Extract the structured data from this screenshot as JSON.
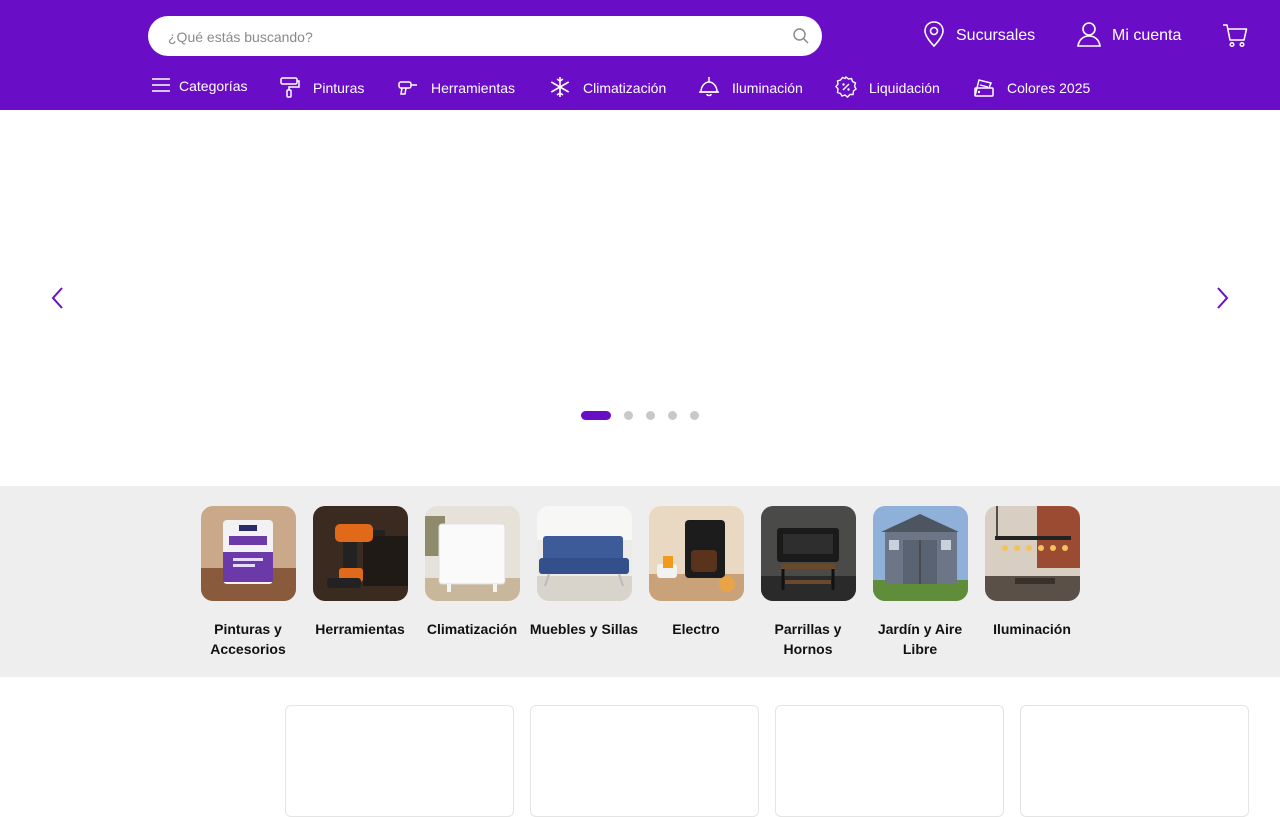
{
  "header": {
    "search": {
      "placeholder": "¿Qué estás buscando?",
      "value": ""
    },
    "links": {
      "stores": "Sucursales",
      "account": "Mi cuenta"
    },
    "icons": {
      "search": "search-icon",
      "stores": "location-pin-icon",
      "account": "user-icon",
      "cart": "cart-icon"
    }
  },
  "nav": {
    "categories": "Categorías",
    "items": [
      {
        "label": "Pinturas",
        "icon": "paint-roller-icon"
      },
      {
        "label": "Herramientas",
        "icon": "drill-icon"
      },
      {
        "label": "Climatización",
        "icon": "snowflake-icon"
      },
      {
        "label": "Iluminación",
        "icon": "ceiling-lamp-icon"
      },
      {
        "label": "Liquidación",
        "icon": "discount-badge-icon"
      },
      {
        "label": "Colores 2025",
        "icon": "color-swatch-icon"
      }
    ]
  },
  "carousel": {
    "slides_count": 5,
    "active_index": 0
  },
  "categories": [
    {
      "label": "Pinturas y Accesorios"
    },
    {
      "label": "Herramientas"
    },
    {
      "label": "Climatización"
    },
    {
      "label": "Muebles y Sillas"
    },
    {
      "label": "Electro"
    },
    {
      "label": "Parrillas y Hornos"
    },
    {
      "label": "Jardín y Aire Libre"
    },
    {
      "label": "Iluminación"
    }
  ],
  "colors": {
    "brand": "#6a0dc7",
    "strip_background": "#eeeeee",
    "dot_inactive": "#c8c8c8"
  }
}
